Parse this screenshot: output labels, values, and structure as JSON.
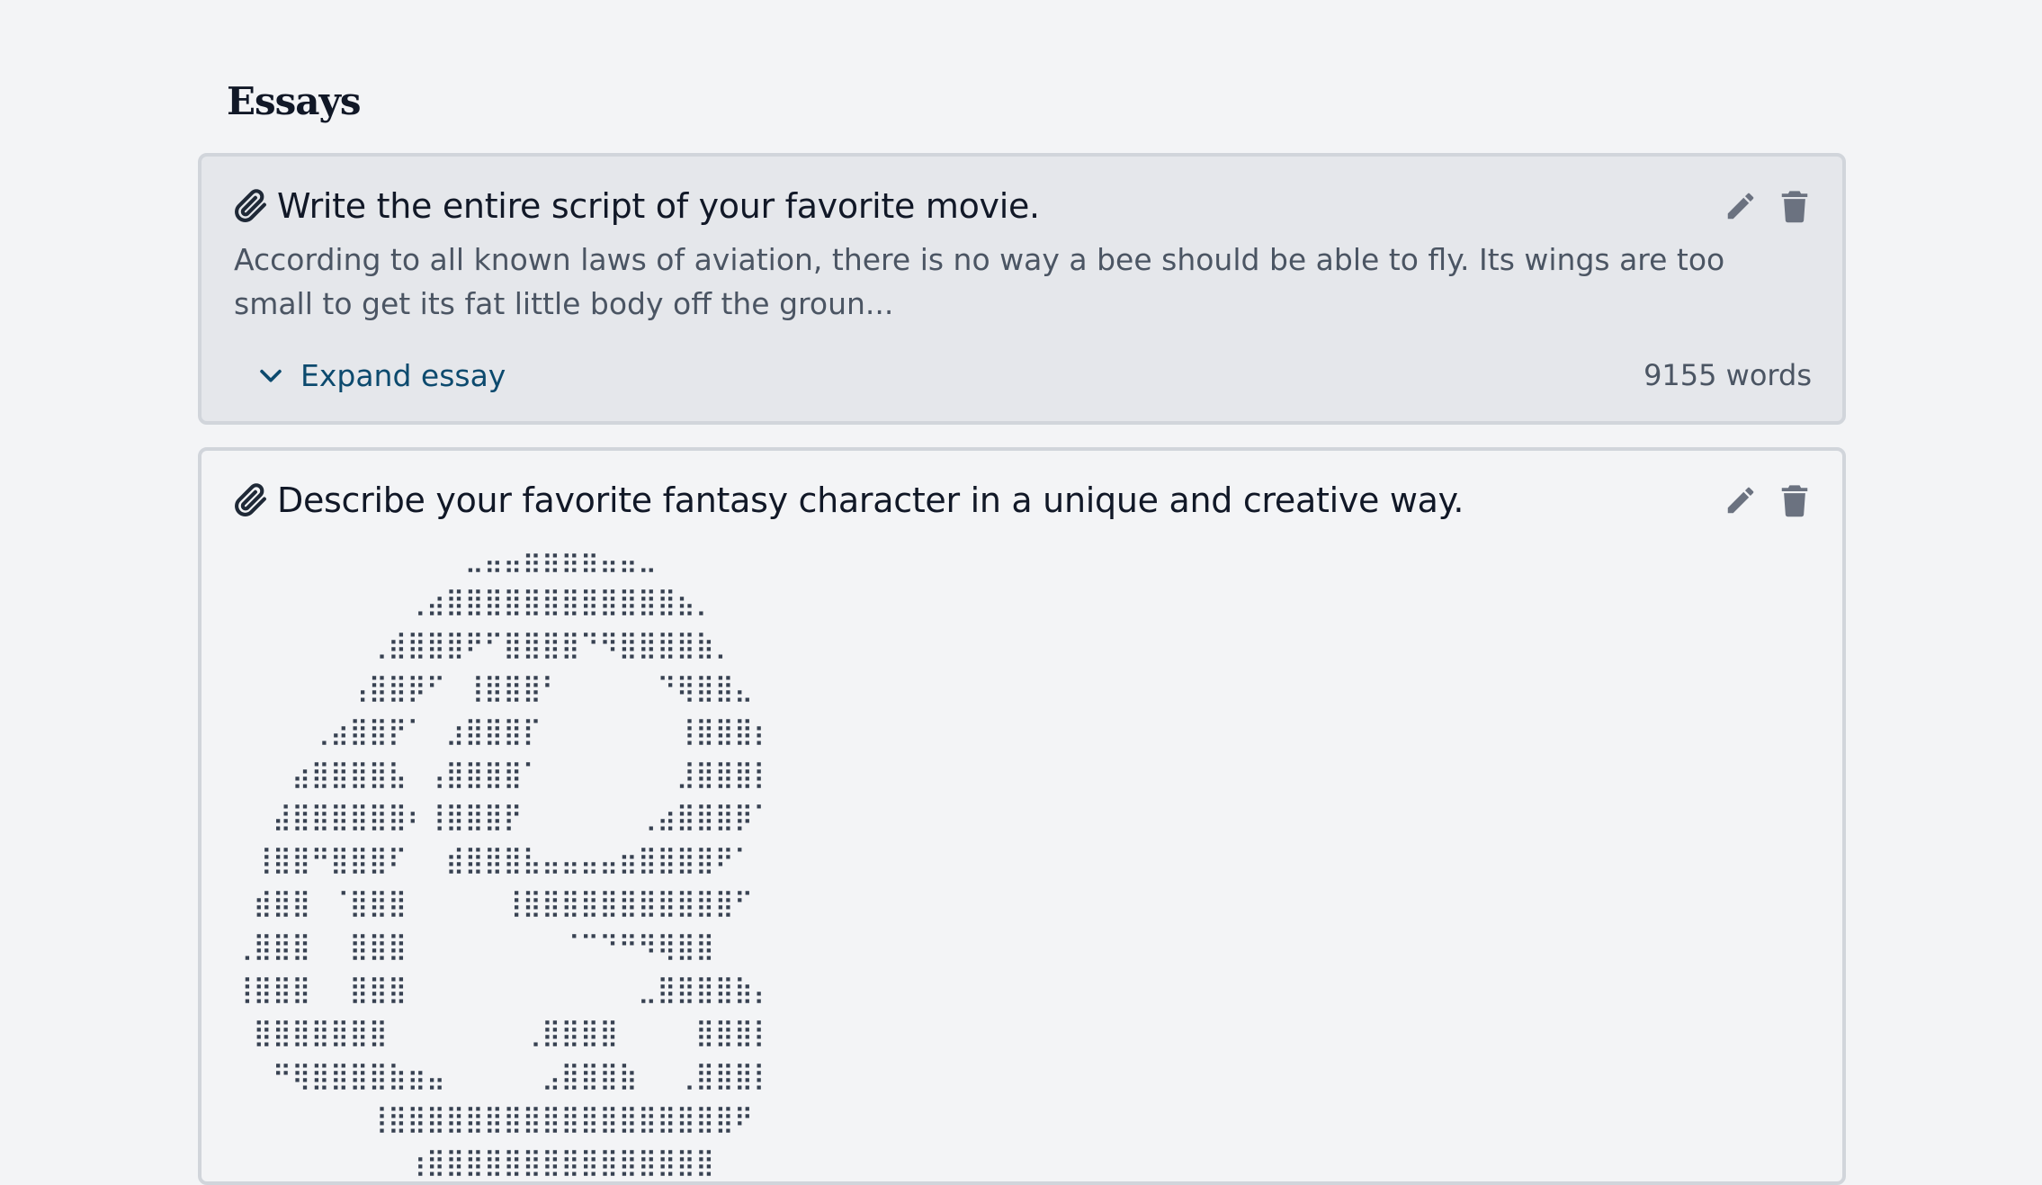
{
  "section": {
    "title": "Essays"
  },
  "essays": [
    {
      "title": "Write the entire script of your favorite movie.",
      "excerpt": "According to all known laws of aviation, there is no way a bee should be able to fly. Its wings are too small to get its fat little body off the groun...",
      "expand_label": "Expand essay",
      "word_count": "9155 words",
      "icons": {
        "attachment": "paperclip-icon",
        "edit": "pencil-icon",
        "delete": "trash-icon",
        "expand": "chevron-down-icon"
      }
    },
    {
      "title": "Describe your favorite fantasy character in a unique and creative way.",
      "body": "⠀⠀⠀⠀⠀⠀⠀⠀⠀⠀⠀⠀⣀⣤⣤⣶⣶⣶⣶⣤⣤⣀⠀⠀⠀⠀⠀⠀⠀⠀⠀⠀\n⠀⠀⠀⠀⠀⠀⠀⠀⠀⢀⣴⣿⣿⣿⣿⣿⣿⣿⣿⣿⣿⣿⣿⣦⡀⠀⠀⠀⠀⠀⠀⠀\n⠀⠀⠀⠀⠀⠀⠀⢀⣾⣿⣿⣿⠟⠋⣿⣿⣿⣿⠙⠻⣿⣿⣿⣿⣷⡀⠀⠀⠀⠀⠀⠀\n⠀⠀⠀⠀⠀⠀⢠⣿⣿⡿⠋⠀⢸⣿⣿⣿⠃⠀⠀⠀⠀⠀⠙⢿⣿⣿⣄⠀⠀⠀⠀⠀\n⠀⠀⠀⠀⢀⣴⣿⣿⡟⠁⠀⣰⣿⣿⣿⡏⠀⠀⠀⠀⠀⠀⠀⢸⣿⣿⣿⡆⠀⠀⠀⠀\n⠀⠀⠀⣴⣿⣿⣿⣿⣧⠀⢠⣿⣿⣿⣿⠁⠀⠀⠀⠀⠀⠀⠀⣸⣿⣿⣿⡇⠀⠀⠀⠀\n⠀⠀⣼⣿⣿⣿⣿⣿⣿⠆⢸⣿⣿⣿⡟⠀⠀⠀⠀⠀⠀⢀⣴⣿⣿⣿⡿⠁⠀⠀⠀⠀\n⠀⢸⣿⣿⠛⣿⣿⣿⠏⠀⠀⣾⣿⣿⣿⣧⣤⣤⣤⣤⣶⣿⣿⣿⣿⠟⠁⠀⠀⠀⠀⠀\n⠀⣾⣿⣿⠀⠈⣿⣿⣿⠀⠀⠀⠀⠀⢸⣿⣿⣿⣿⣿⣿⣿⣿⣿⣿⣿⠋⠀⠀⠀⠀⠀⠀\n⢀⣿⣿⣿⠀⠀⣿⣿⣿⠀⠀⠀⠀⠀⠀⠀⠀⠈⠉⠙⠛⠻⢿⣿⣿⠀⠀⠀⠀⠀⠀⠀⠀\n⢸⣿⣿⣿⠀⠀⣿⣿⣿⠀⠀⠀⠀⠀⠀⠀⠀⠀⠀⠀⠀⣀⣿⣿⣿⣿⣷⡄⠀⠀⠀⠀⠀\n⠀⣿⣿⣿⣿⣿⣿⣿⠀⠀⠀⠀⠀⠀⠀⢀⣿⣿⣿⣿⠀⠀⠀⠀⣿⣿⣿⡇⠀⠀⠀⠀⠀\n⠀⠀⠛⢿⣿⣿⣿⣿⣷⣶⣤⠀⠀⠀⠀⠀⣠⣿⣿⣿⣷⠀⠀⢀⣿⣿⣿⡇⠀⠀⠀⠀⠀\n⠀⠀⠀⠀⠀⠀⠀⢸⣿⣿⣿⣿⣿⣿⣿⣿⣿⣿⣿⣿⣿⣿⣿⣿⣿⣿⠟⠀⠀⠀⠀⠀⠀\n⠀⠀⠀⠀⠀⠀⠀⠀⠀⢰⣿⣿⣿⣿⣿⣿⣿⣿⣿⣿⣿⣿⣿⣿⣿⠀⠀⠀⠀⠀⠀⠀⠀",
      "icons": {
        "attachment": "paperclip-icon",
        "edit": "pencil-icon",
        "delete": "trash-icon"
      }
    }
  ],
  "colors": {
    "background": "#f3f4f6",
    "card_collapsed_bg": "#e5e7eb",
    "card_border": "#d1d5db",
    "link": "#0c4a6e",
    "icon": "#6b7280"
  }
}
